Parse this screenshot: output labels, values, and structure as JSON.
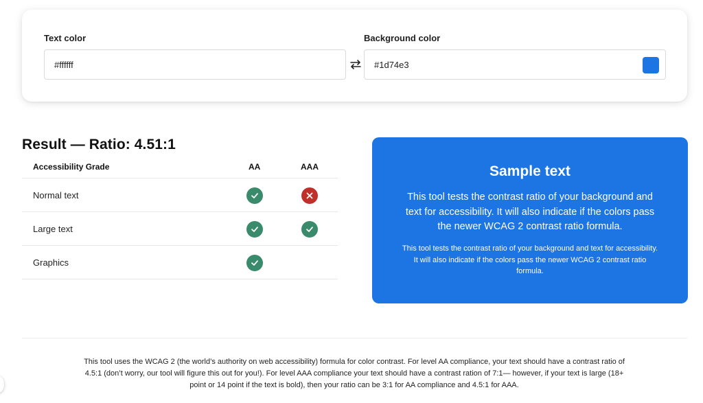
{
  "inputs": {
    "text_color": {
      "label": "Text color",
      "value": "#ffffff"
    },
    "background_color": {
      "label": "Background color",
      "value": "#1d74e3"
    }
  },
  "swap_icon": "swap-arrows-icon",
  "result": {
    "title": "Result — Ratio: 4.51:1",
    "ratio": "4.51:1",
    "columns": {
      "grade": "Accessibility Grade",
      "aa": "AA",
      "aaa": "AAA"
    },
    "rows": [
      {
        "label": "Normal text",
        "aa": "pass",
        "aaa": "fail"
      },
      {
        "label": "Large text",
        "aa": "pass",
        "aaa": "pass"
      },
      {
        "label": "Graphics",
        "aa": "pass",
        "aaa": ""
      }
    ]
  },
  "colors": {
    "pass": "#3a8a6c",
    "fail": "#c0302b"
  },
  "sample": {
    "title": "Sample text",
    "large_text": "This tool tests the contrast ratio of your background and text for accessibility. It will also indicate if the colors pass the newer WCAG 2 contrast ratio formula.",
    "small_text": "This tool tests the contrast ratio of your background and text for accessibility. It will also indicate if the colors pass the newer WCAG 2 contrast ratio formula."
  },
  "footnote": "This tool uses the WCAG 2 (the world’s authority on web accessibility) formula for color contrast. For level AA compliance, your text should have a contrast ratio of 4.5:1 (don’t worry, our tool will figure this out for you!). For level AAA compliance your text should have a contrast ration of 7:1— however, if your text is large (18+ point or 14 point if the text is bold), then your ratio can be 3:1 for AA compliance and 4.5:1 for AAA."
}
